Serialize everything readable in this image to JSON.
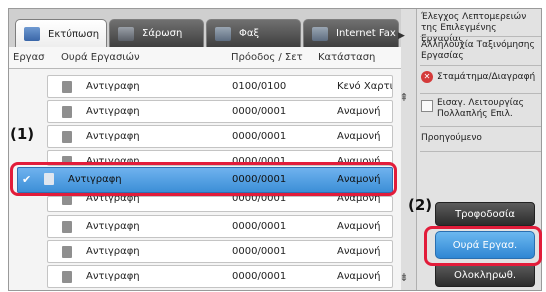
{
  "tabs": [
    {
      "label": "Εκτύπωση",
      "icon": "print-icon",
      "active": true
    },
    {
      "label": "Σάρωση",
      "icon": "scan-icon",
      "active": false
    },
    {
      "label": "Φαξ",
      "icon": "fax-icon",
      "active": false
    },
    {
      "label": "Internet Fax",
      "icon": "internet-fax-icon",
      "active": false
    }
  ],
  "table": {
    "headers": {
      "type": "Εργασ",
      "name": "Ουρά Εργασιών",
      "progress": "Πρόοδος / Σετ",
      "status": "Κατάσταση"
    },
    "rows": [
      {
        "name": "Αντιγραφη",
        "progress": "0100/0100",
        "status": "Κενό Χαρτιού"
      },
      {
        "name": "Αντιγραφη",
        "progress": "0000/0001",
        "status": "Αναμονή"
      },
      {
        "name": "Αντιγραφη",
        "progress": "0000/0001",
        "status": "Αναμονή"
      },
      {
        "name": "Αντιγραφη",
        "progress": "0000/0001",
        "status": "Αναμονή"
      },
      {
        "name": "Αντιγραφη",
        "progress": "0000/0001",
        "status": "Αναμονή",
        "selected": true
      },
      {
        "name": "Αντιγραφη",
        "progress": "0000/0001",
        "status": "Αναμονή"
      },
      {
        "name": "Αντιγραφη",
        "progress": "0000/0001",
        "status": "Αναμονή"
      },
      {
        "name": "Αντιγραφη",
        "progress": "0000/0001",
        "status": "Αναμονή"
      },
      {
        "name": "Αντιγραφη",
        "progress": "0000/0001",
        "status": "Αναμονή"
      }
    ]
  },
  "panel": {
    "check_details": "Έλεγχος Λεπτομερειών της Επιλεγμένης Εργασίας",
    "sort_order": "Αλληλουχία Ταξινόμησης Εργασίας",
    "stop_delete": "Σταμάτημα/Διαγραφή",
    "special_mode": "Εισαγ. Λειτουργίας Πολλαπλής Επιλ.",
    "previous": "Προηγούμενο",
    "feed": "Τροφοδοσία",
    "job_queue": "Ουρά Εργασ.",
    "complete": "Ολοκληρωθ."
  },
  "callouts": {
    "one": "(1)",
    "two": "(2)"
  },
  "colors": {
    "highlight": "#e21c3a",
    "selected_row": "#3c8fd7",
    "blue_button": "#2f86d3"
  }
}
